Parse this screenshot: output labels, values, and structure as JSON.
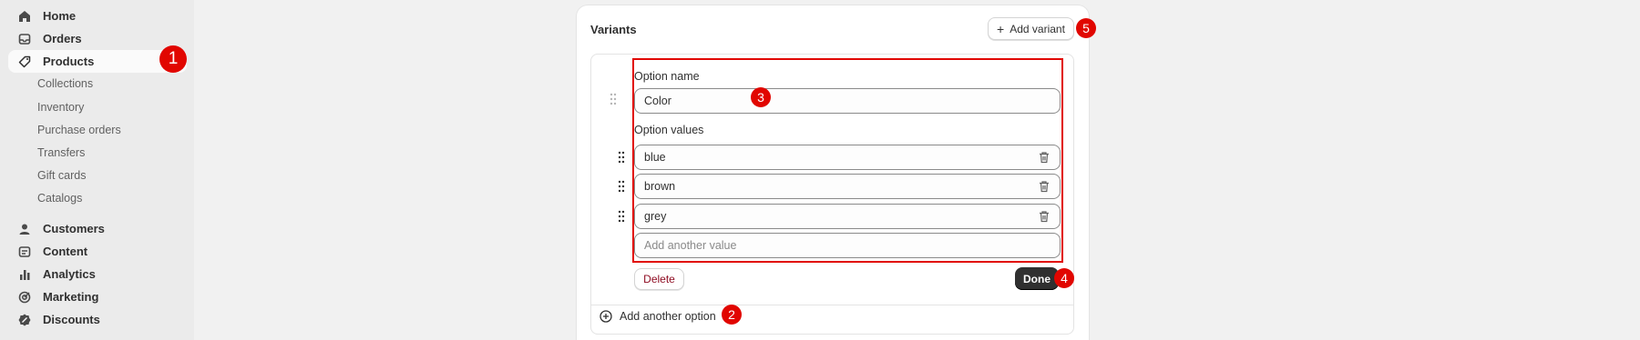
{
  "sidebar": {
    "items": [
      {
        "label": "Home",
        "icon": "home-icon"
      },
      {
        "label": "Orders",
        "icon": "orders-inbox-icon"
      },
      {
        "label": "Products",
        "icon": "tag-icon",
        "active": true
      },
      {
        "label": "Customers",
        "icon": "person-icon"
      },
      {
        "label": "Content",
        "icon": "content-image-icon"
      },
      {
        "label": "Analytics",
        "icon": "bar-chart-icon"
      },
      {
        "label": "Marketing",
        "icon": "target-icon"
      },
      {
        "label": "Discounts",
        "icon": "discount-badge-icon"
      }
    ],
    "subitems": [
      "Collections",
      "Inventory",
      "Purchase orders",
      "Transfers",
      "Gift cards",
      "Catalogs"
    ]
  },
  "variants": {
    "title": "Variants",
    "add_variant_label": "Add variant",
    "option_name_label": "Option name",
    "option_name_value": "Color",
    "option_values_label": "Option values",
    "values": [
      "blue",
      "brown",
      "grey"
    ],
    "add_value_placeholder": "Add another value",
    "delete_label": "Delete",
    "done_label": "Done",
    "add_option_label": "Add another option"
  },
  "markers": [
    "1",
    "2",
    "3",
    "4",
    "5"
  ],
  "colors": {
    "marker": "#e10600",
    "done_button": "#303030",
    "delete_text": "#8e0b21",
    "sidebar_bg": "#ebebeb",
    "page_bg": "#f1f1f1"
  }
}
